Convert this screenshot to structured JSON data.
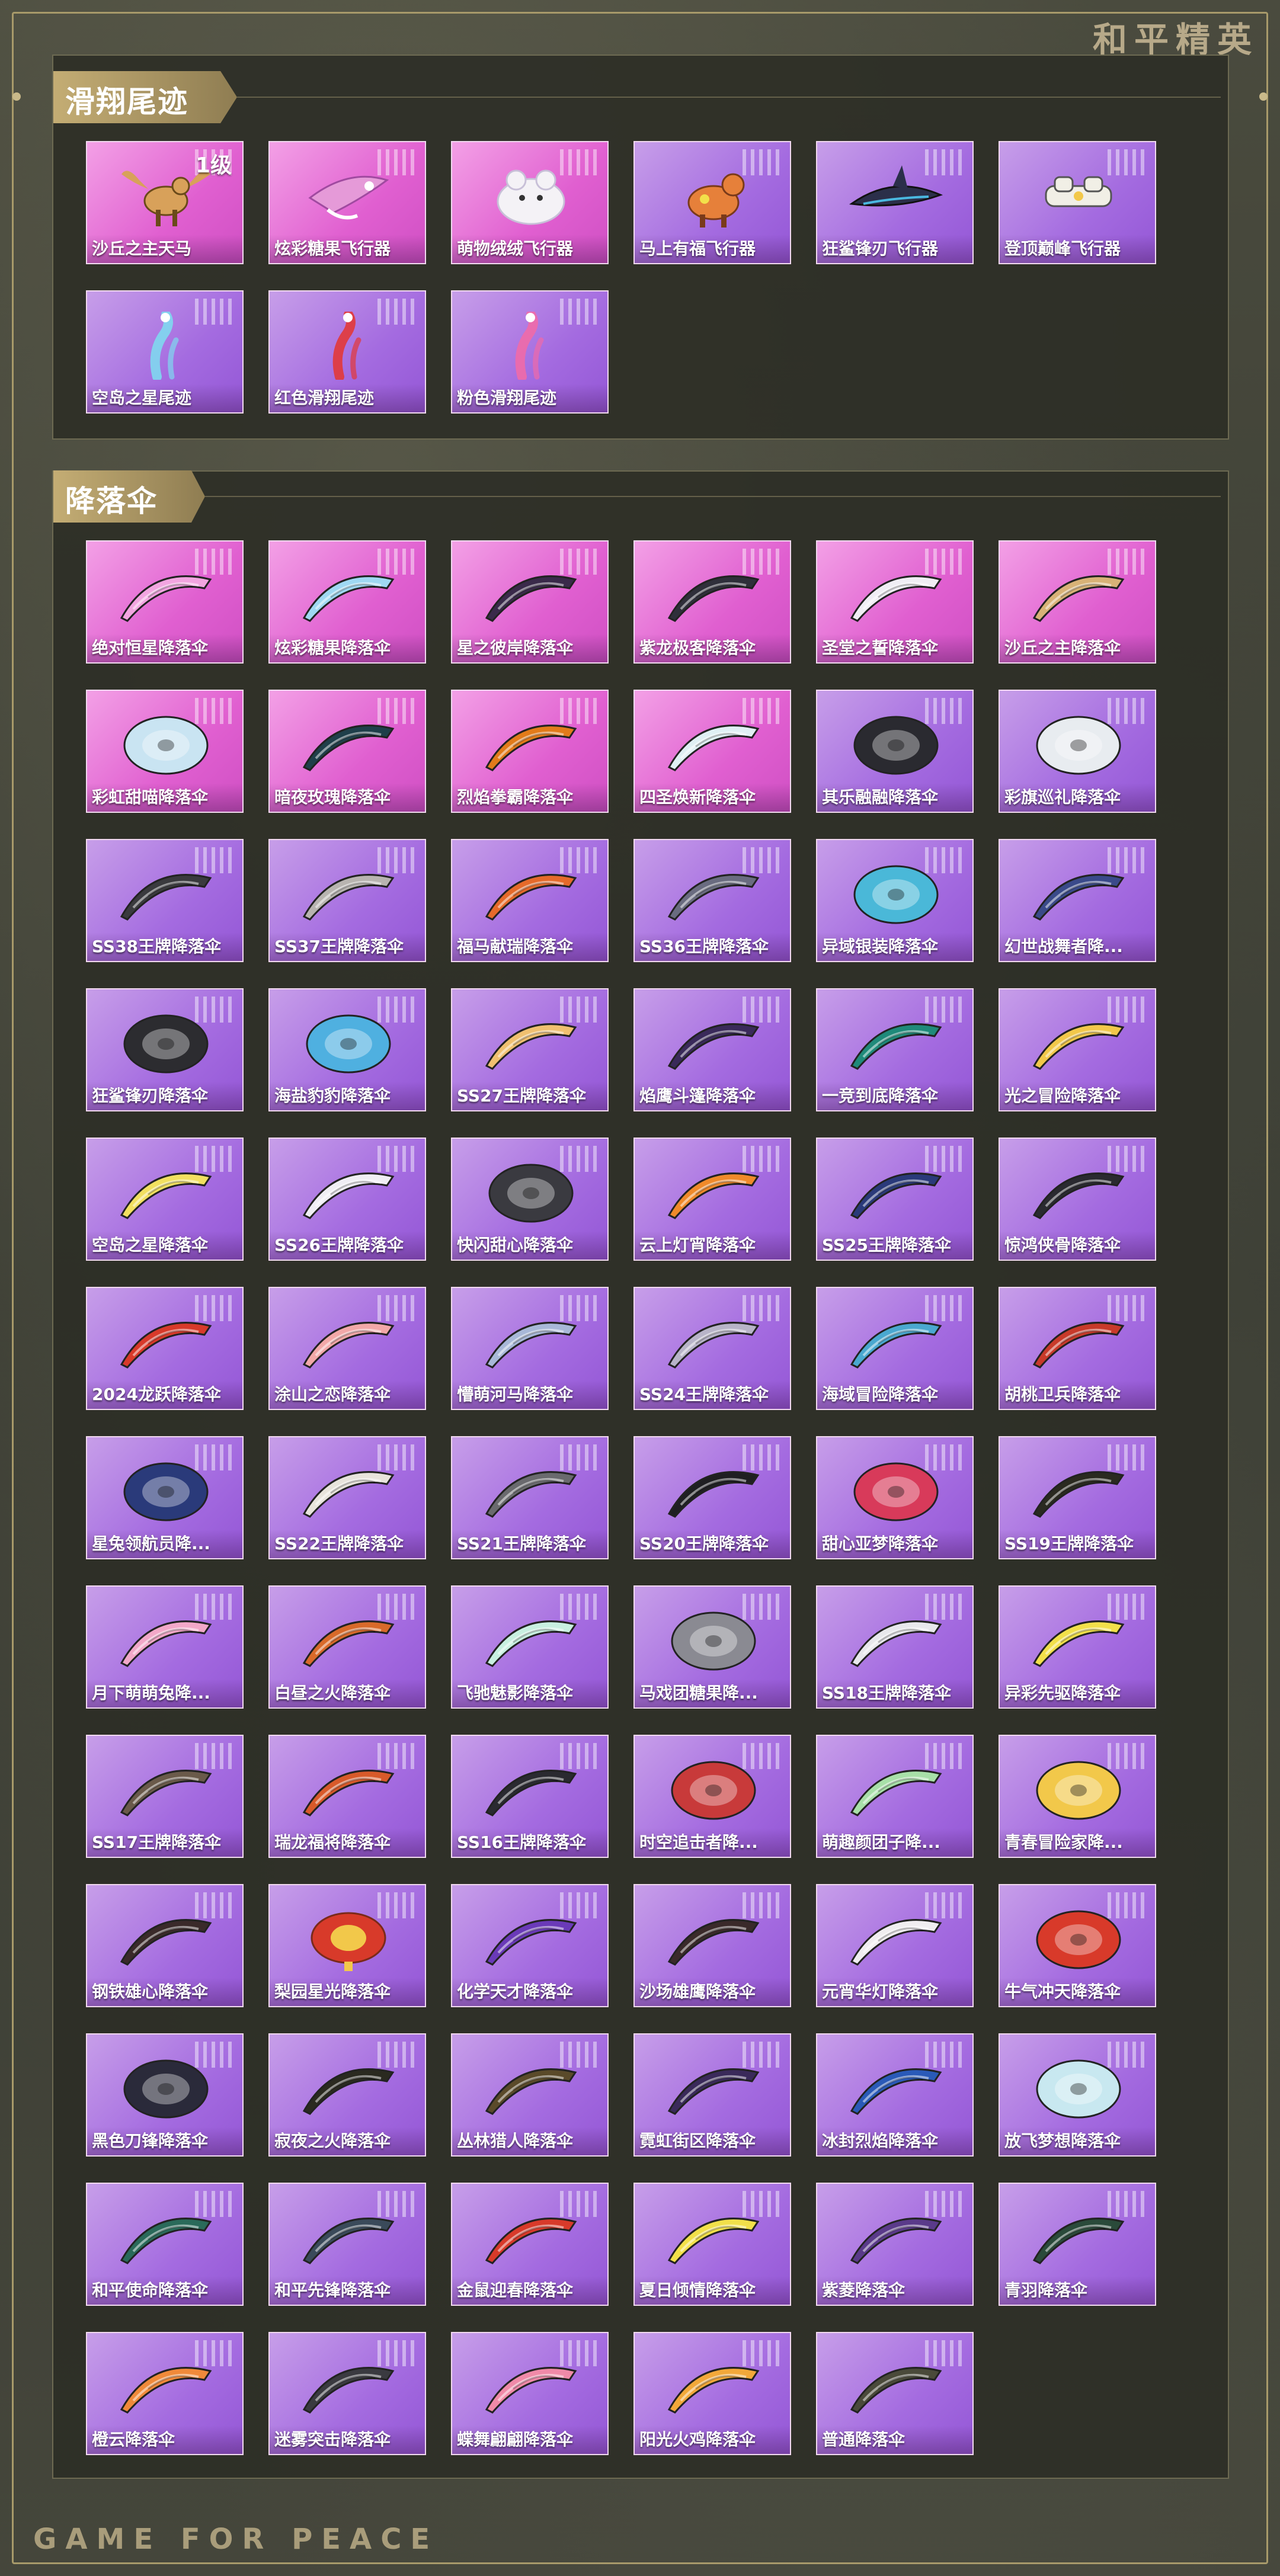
{
  "brand": "和平精英",
  "footer": "GAME FOR PEACE",
  "sections": [
    {
      "title": "滑翔尾迹",
      "items": [
        {
          "label": "沙丘之主天马",
          "rarity": "pink",
          "badge": "1级",
          "art": "pegasus",
          "color": "#d8a15a"
        },
        {
          "label": "炫彩糖果飞行器",
          "rarity": "pink",
          "art": "glider",
          "color": "#e59ad8"
        },
        {
          "label": "萌物绒绒飞行器",
          "rarity": "pink",
          "art": "plush",
          "color": "#f4f2f6"
        },
        {
          "label": "马上有福飞行器",
          "rarity": "purple",
          "art": "horse",
          "color": "#e6803a"
        },
        {
          "label": "狂鲨锋刃飞行器",
          "rarity": "purple",
          "art": "shark",
          "color": "#2b2f4a"
        },
        {
          "label": "登顶巅峰飞行器",
          "rarity": "purple",
          "art": "jet",
          "color": "#f1efe6"
        },
        {
          "label": "空岛之星尾迹",
          "rarity": "purple",
          "art": "trail",
          "color": "#7fd8f0"
        },
        {
          "label": "红色滑翔尾迹",
          "rarity": "purple",
          "art": "trail",
          "color": "#e23838"
        },
        {
          "label": "粉色滑翔尾迹",
          "rarity": "purple",
          "art": "trail",
          "color": "#f06aa8"
        }
      ]
    },
    {
      "title": "降落伞",
      "items": [
        {
          "label": "绝对恒星降落伞",
          "rarity": "pink",
          "art": "parachute",
          "color": "#f2a5e0"
        },
        {
          "label": "炫彩糖果降落伞",
          "rarity": "pink",
          "art": "parachute",
          "color": "#9fd8f2"
        },
        {
          "label": "星之彼岸降落伞",
          "rarity": "pink",
          "art": "parachute",
          "color": "#3a2a4a"
        },
        {
          "label": "紫龙极客降落伞",
          "rarity": "pink",
          "art": "parachute",
          "color": "#2f2f3a"
        },
        {
          "label": "圣堂之誓降落伞",
          "rarity": "pink",
          "art": "parachute",
          "color": "#f0eef4"
        },
        {
          "label": "沙丘之主降落伞",
          "rarity": "pink",
          "art": "parachute",
          "color": "#d8b277"
        },
        {
          "label": "彩虹甜喵降落伞",
          "rarity": "pink",
          "art": "dome",
          "color": "#c9e4f2"
        },
        {
          "label": "暗夜玫瑰降落伞",
          "rarity": "pink",
          "art": "parachute",
          "color": "#1f3f4a"
        },
        {
          "label": "烈焰拳霸降落伞",
          "rarity": "pink",
          "art": "parachute",
          "color": "#e27b1a"
        },
        {
          "label": "四圣焕新降落伞",
          "rarity": "pink",
          "art": "parachute",
          "color": "#e0f0f4"
        },
        {
          "label": "其乐融融降落伞",
          "rarity": "purple",
          "art": "dome",
          "color": "#2a2a30"
        },
        {
          "label": "彩旗巡礼降落伞",
          "rarity": "purple",
          "art": "dome",
          "color": "#e8ecf0"
        },
        {
          "label": "SS38王牌降落伞",
          "rarity": "purple",
          "art": "parachute",
          "color": "#3a3a3e"
        },
        {
          "label": "SS37王牌降落伞",
          "rarity": "purple",
          "art": "parachute",
          "color": "#b8b4b0"
        },
        {
          "label": "福马献瑞降落伞",
          "rarity": "purple",
          "art": "parachute",
          "color": "#e56a2a"
        },
        {
          "label": "SS36王牌降落伞",
          "rarity": "purple",
          "art": "parachute",
          "color": "#6a6c80"
        },
        {
          "label": "异域银装降落伞",
          "rarity": "purple",
          "art": "dome",
          "color": "#4ab8d8"
        },
        {
          "label": "幻世战舞者降...",
          "rarity": "purple",
          "art": "parachute",
          "color": "#3a4a8a"
        },
        {
          "label": "狂鲨锋刃降落伞",
          "rarity": "purple",
          "art": "dome",
          "color": "#2c2c30"
        },
        {
          "label": "海盐豹豹降落伞",
          "rarity": "purple",
          "art": "dome",
          "color": "#4fb0e0"
        },
        {
          "label": "SS27王牌降落伞",
          "rarity": "purple",
          "art": "parachute",
          "color": "#f0c070"
        },
        {
          "label": "焰鹰斗篷降落伞",
          "rarity": "purple",
          "art": "parachute",
          "color": "#3a2a5a"
        },
        {
          "label": "一竞到底降落伞",
          "rarity": "purple",
          "art": "parachute",
          "color": "#1f8a7a"
        },
        {
          "label": "光之冒险降落伞",
          "rarity": "purple",
          "art": "parachute",
          "color": "#f2c84a"
        },
        {
          "label": "空岛之星降落伞",
          "rarity": "purple",
          "art": "parachute",
          "color": "#f2e060"
        },
        {
          "label": "SS26王牌降落伞",
          "rarity": "purple",
          "art": "parachute",
          "color": "#f0eef4"
        },
        {
          "label": "快闪甜心降落伞",
          "rarity": "purple",
          "art": "dome",
          "color": "#3a3a40"
        },
        {
          "label": "云上灯宵降落伞",
          "rarity": "purple",
          "art": "parachute",
          "color": "#f08a2a"
        },
        {
          "label": "SS25王牌降落伞",
          "rarity": "purple",
          "art": "parachute",
          "color": "#2a3a7a"
        },
        {
          "label": "惊鸿侠骨降落伞",
          "rarity": "purple",
          "art": "parachute",
          "color": "#2a2a30"
        },
        {
          "label": "2024龙跃降落伞",
          "rarity": "purple",
          "art": "parachute",
          "color": "#d83a2a"
        },
        {
          "label": "涂山之恋降落伞",
          "rarity": "purple",
          "art": "parachute",
          "color": "#f2a8a8"
        },
        {
          "label": "懵萌河马降落伞",
          "rarity": "purple",
          "art": "parachute",
          "color": "#a8b8d8"
        },
        {
          "label": "SS24王牌降落伞",
          "rarity": "purple",
          "art": "parachute",
          "color": "#b8b4c8"
        },
        {
          "label": "海域冒险降落伞",
          "rarity": "purple",
          "art": "parachute",
          "color": "#4aa8d0"
        },
        {
          "label": "胡桃卫兵降落伞",
          "rarity": "purple",
          "art": "parachute",
          "color": "#c83a2a"
        },
        {
          "label": "星兔领航员降...",
          "rarity": "purple",
          "art": "dome",
          "color": "#2a3a7a"
        },
        {
          "label": "SS22王牌降落伞",
          "rarity": "purple",
          "art": "parachute",
          "color": "#e8e4dc"
        },
        {
          "label": "SS21王牌降落伞",
          "rarity": "purple",
          "art": "parachute",
          "color": "#6a6a6e"
        },
        {
          "label": "SS20王牌降落伞",
          "rarity": "purple",
          "art": "parachute",
          "color": "#1f1f22"
        },
        {
          "label": "甜心亚梦降落伞",
          "rarity": "purple",
          "art": "dome",
          "color": "#d83a5a"
        },
        {
          "label": "SS19王牌降落伞",
          "rarity": "purple",
          "art": "parachute",
          "color": "#2a2a20"
        },
        {
          "label": "月下萌萌兔降...",
          "rarity": "purple",
          "art": "parachute",
          "color": "#f2a8c8"
        },
        {
          "label": "白昼之火降落伞",
          "rarity": "purple",
          "art": "parachute",
          "color": "#d86a2a"
        },
        {
          "label": "飞驰魅影降落伞",
          "rarity": "purple",
          "art": "parachute",
          "color": "#c8f0e0"
        },
        {
          "label": "马戏团糖果降...",
          "rarity": "purple",
          "art": "dome",
          "color": "#8a8a92"
        },
        {
          "label": "SS18王牌降落伞",
          "rarity": "purple",
          "art": "parachute",
          "color": "#e8e8ec"
        },
        {
          "label": "异彩先驱降落伞",
          "rarity": "purple",
          "art": "parachute",
          "color": "#f2e04a"
        },
        {
          "label": "SS17王牌降落伞",
          "rarity": "purple",
          "art": "parachute",
          "color": "#6a5a4a"
        },
        {
          "label": "瑞龙福将降落伞",
          "rarity": "purple",
          "art": "parachute",
          "color": "#d85a2a"
        },
        {
          "label": "SS16王牌降落伞",
          "rarity": "purple",
          "art": "parachute",
          "color": "#2a2a30"
        },
        {
          "label": "时空追击者降...",
          "rarity": "purple",
          "art": "dome",
          "color": "#c83a3a"
        },
        {
          "label": "萌趣颜团子降...",
          "rarity": "purple",
          "art": "parachute",
          "color": "#a8e0a8"
        },
        {
          "label": "青春冒险家降...",
          "rarity": "purple",
          "art": "dome",
          "color": "#f2c84a"
        },
        {
          "label": "钢铁雄心降落伞",
          "rarity": "purple",
          "art": "parachute",
          "color": "#3a2a2a"
        },
        {
          "label": "梨园星光降落伞",
          "rarity": "purple",
          "art": "lantern",
          "color": "#d83a2a"
        },
        {
          "label": "化学天才降落伞",
          "rarity": "purple",
          "art": "parachute",
          "color": "#6a3ab8"
        },
        {
          "label": "沙场雄鹰降落伞",
          "rarity": "purple",
          "art": "parachute",
          "color": "#3a2a2a"
        },
        {
          "label": "元宵华灯降落伞",
          "rarity": "purple",
          "art": "parachute",
          "color": "#f0eef0"
        },
        {
          "label": "牛气冲天降落伞",
          "rarity": "purple",
          "art": "dome",
          "color": "#d83a2a"
        },
        {
          "label": "黑色刀锋降落伞",
          "rarity": "purple",
          "art": "dome",
          "color": "#2a2a3a"
        },
        {
          "label": "寂夜之火降落伞",
          "rarity": "purple",
          "art": "parachute",
          "color": "#2a2a20"
        },
        {
          "label": "丛林猎人降落伞",
          "rarity": "purple",
          "art": "parachute",
          "color": "#5a4a2a"
        },
        {
          "label": "霓虹街区降落伞",
          "rarity": "purple",
          "art": "parachute",
          "color": "#3a2a5a"
        },
        {
          "label": "冰封烈焰降落伞",
          "rarity": "purple",
          "art": "parachute",
          "color": "#2a5ab8"
        },
        {
          "label": "放飞梦想降落伞",
          "rarity": "purple",
          "art": "dome",
          "color": "#c8e8f0"
        },
        {
          "label": "和平使命降落伞",
          "rarity": "purple",
          "art": "parachute",
          "color": "#2a6a5a"
        },
        {
          "label": "和平先锋降落伞",
          "rarity": "purple",
          "art": "parachute",
          "color": "#3a4a5a"
        },
        {
          "label": "金鼠迎春降落伞",
          "rarity": "purple",
          "art": "parachute",
          "color": "#d83a2a"
        },
        {
          "label": "夏日倾情降落伞",
          "rarity": "purple",
          "art": "parachute",
          "color": "#f2e04a"
        },
        {
          "label": "紫菱降落伞",
          "rarity": "purple",
          "art": "parachute",
          "color": "#5a3a8a"
        },
        {
          "label": "青羽降落伞",
          "rarity": "purple",
          "art": "parachute",
          "color": "#2a4a3a"
        },
        {
          "label": "橙云降落伞",
          "rarity": "purple",
          "art": "parachute",
          "color": "#f08a3a"
        },
        {
          "label": "迷雾突击降落伞",
          "rarity": "purple",
          "art": "parachute",
          "color": "#3a3a40"
        },
        {
          "label": "蝶舞翩翩降落伞",
          "rarity": "purple",
          "art": "parachute",
          "color": "#f08aa8"
        },
        {
          "label": "阳光火鸡降落伞",
          "rarity": "purple",
          "art": "parachute",
          "color": "#f2a83a"
        },
        {
          "label": "普通降落伞",
          "rarity": "purple",
          "art": "parachute",
          "color": "#4a4a3a"
        }
      ]
    }
  ]
}
